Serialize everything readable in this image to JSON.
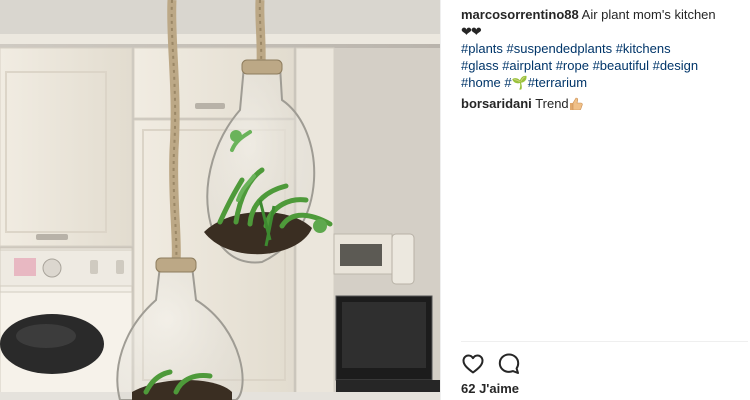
{
  "post": {
    "author": "marcosorrentino88",
    "caption": "Air plant mom's kitchen",
    "hearts": "❤❤",
    "tags_line1": [
      "#plants",
      "#suspendedplants",
      "#kitchens"
    ],
    "tags_line2": [
      "#glass",
      "#airplant",
      "#rope",
      "#beautiful",
      "#design"
    ],
    "tag_home": "#home",
    "tag_hash": "#",
    "sprout_emoji": "🌱",
    "tag_terrarium": "#terrarium"
  },
  "comments": [
    {
      "author": "borsaridani",
      "text": "Trend",
      "emoji": "thumbs-up"
    }
  ],
  "actions": {
    "like_icon": "heart-outline-icon",
    "comment_icon": "speech-bubble-icon"
  },
  "likes_label": "62 J'aime",
  "colors": {
    "text": "#262626",
    "hashtag": "#003569",
    "divider": "#efefef"
  }
}
